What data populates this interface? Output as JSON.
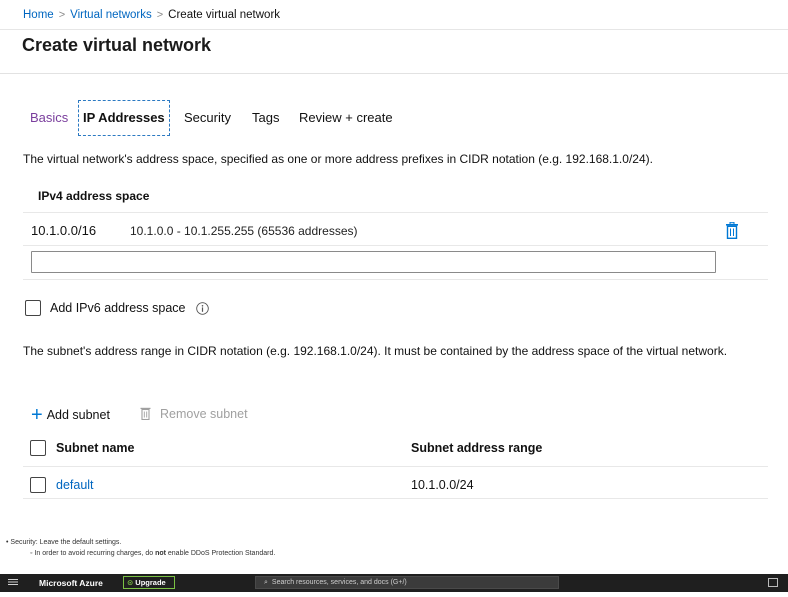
{
  "breadcrumb": {
    "home": "Home",
    "virtual_networks": "Virtual networks",
    "current": "Create virtual network",
    "separator": ">"
  },
  "page": {
    "title": "Create virtual network"
  },
  "tabs": [
    {
      "label": "Basics",
      "state": "visited"
    },
    {
      "label": "IP Addresses",
      "state": "active"
    },
    {
      "label": "Security",
      "state": "normal"
    },
    {
      "label": "Tags",
      "state": "normal"
    },
    {
      "label": "Review + create",
      "state": "normal"
    }
  ],
  "ip": {
    "description": "The virtual network's address space, specified as one or more address prefixes in CIDR notation (e.g. 192.168.1.0/24).",
    "section_title": "IPv4 address space",
    "entries": [
      {
        "cidr": "10.1.0.0/16",
        "range": "10.1.0.0 - 10.1.255.255 (65536 addresses)"
      }
    ],
    "new_input_value": "",
    "ipv6_checkbox": {
      "label": "Add IPv6 address space",
      "checked": false
    }
  },
  "subnet": {
    "description": "The subnet's address range in CIDR notation (e.g. 192.168.1.0/24). It must be contained by the address space of the virtual network.",
    "add_label": "Add subnet",
    "remove_label": "Remove subnet",
    "columns": [
      "Subnet name",
      "Subnet address range"
    ],
    "rows": [
      {
        "name": "default",
        "range": "10.1.0.0/24"
      }
    ]
  },
  "notes": {
    "item": "Security: Leave the default settings.",
    "subitem_pre": "In order to avoid recurring charges, do ",
    "subitem_bold": "not",
    "subitem_post": " enable DDoS Protection Standard."
  },
  "azure_bar": {
    "brand": "Microsoft Azure",
    "upgrade_label": "Upgrade",
    "search_placeholder": "Search resources, services, and docs (G+/)"
  },
  "colors": {
    "link": "#0066c0",
    "visited_tab": "#7a3e9d",
    "accent": "#0078d4",
    "topbar": "#1f1f1f",
    "upgrade_border": "#7ac143"
  }
}
